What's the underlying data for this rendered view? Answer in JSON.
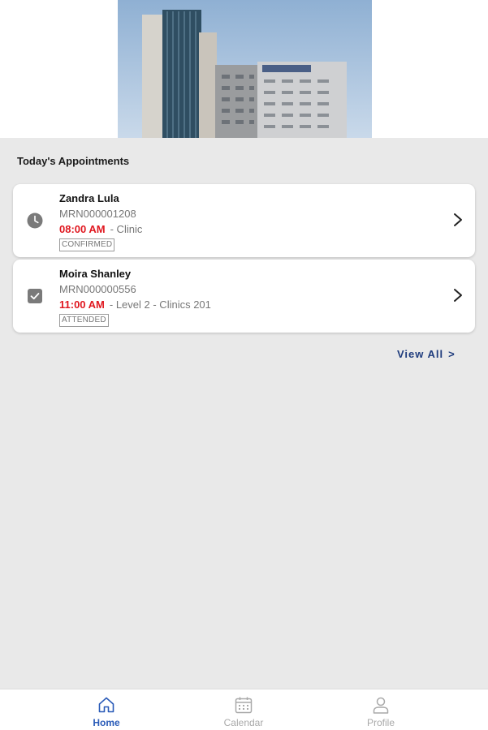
{
  "section": {
    "title": "Today's Appointments"
  },
  "appointments": [
    {
      "name": "Zandra Lula",
      "mrn": "MRN000001208",
      "time": "08:00 AM",
      "location": "- Clinic",
      "status": "CONFIRMED",
      "status_icon": "clock-icon"
    },
    {
      "name": "Moira Shanley",
      "mrn": "MRN000000556",
      "time": "11:00 AM",
      "location": "- Level 2 - Clinics 201",
      "status": "ATTENDED",
      "status_icon": "checkbox-checked-icon"
    }
  ],
  "view_all": {
    "label": "View All",
    "arrow": ">"
  },
  "nav": {
    "items": [
      {
        "label": "Home",
        "icon": "home-icon",
        "active": true
      },
      {
        "label": "Calendar",
        "icon": "calendar-icon",
        "active": false
      },
      {
        "label": "Profile",
        "icon": "profile-icon",
        "active": false
      }
    ]
  },
  "colors": {
    "accent_red": "#e0171f",
    "link_blue": "#1f3c7d",
    "nav_active": "#2a5bb8",
    "background": "#e9e9e9"
  }
}
